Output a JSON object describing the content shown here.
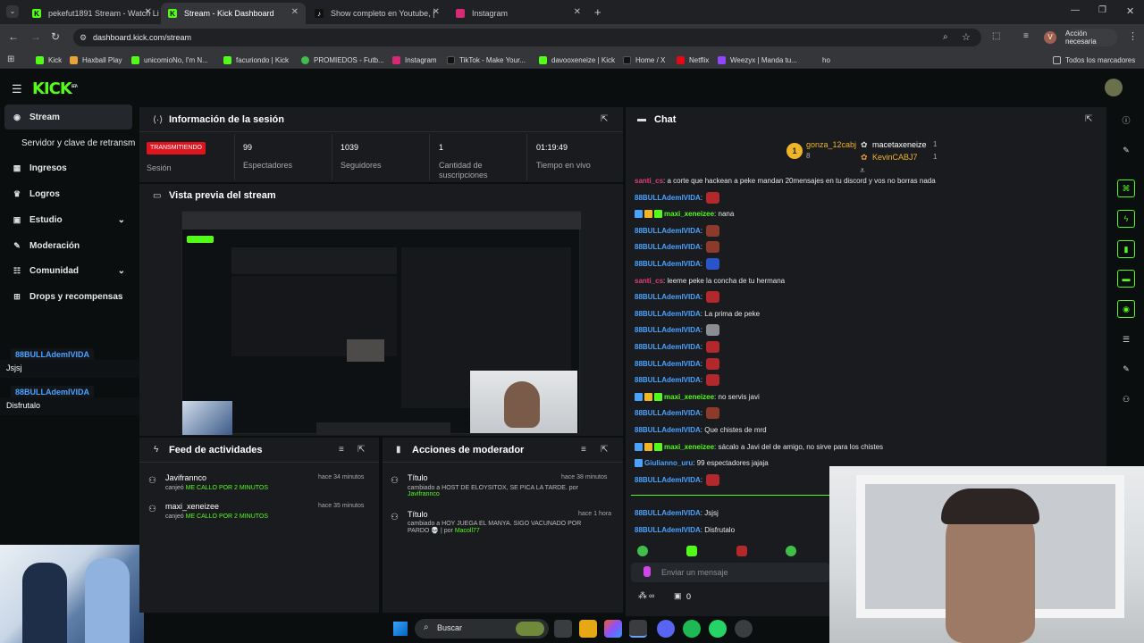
{
  "browser": {
    "tabs": [
      {
        "title": "pekefut1891 Stream - Watch Li",
        "active": false
      },
      {
        "title": "Stream - Kick Dashboard",
        "active": true
      },
      {
        "title": "Show completo en Youtube, |",
        "active": false
      },
      {
        "title": "Instagram",
        "active": false
      }
    ],
    "url": "dashboard.kick.com/stream",
    "action_required": "Acción necesaria",
    "profile_letter": "V",
    "bookmarks": [
      "Kick",
      "Haxball Play",
      "unicomioNo, I'm N...",
      "facuriondo | Kick",
      "PROMIEDOS - Futb...",
      "Instagram",
      "TikTok - Make Your...",
      "davooxeneize | Kick",
      "Home / X",
      "Netflix",
      "Weezyx | Manda tu...",
      "ho"
    ],
    "all_bookmarks": "Todos los marcadores"
  },
  "kick": {
    "logo": "KICK",
    "logo_sup": "BETA"
  },
  "sidebar": {
    "items": [
      {
        "label": "Stream",
        "icon": "stream-icon",
        "glyph": "((·))"
      },
      {
        "label": "Servidor y clave de retransm",
        "icon": "",
        "glyph": ""
      },
      {
        "label": "Ingresos",
        "icon": "revenue-icon",
        "glyph": "▦"
      },
      {
        "label": "Logros",
        "icon": "trophy-icon",
        "glyph": "♛"
      },
      {
        "label": "Estudio",
        "icon": "studio-icon",
        "glyph": "▣"
      },
      {
        "label": "Moderación",
        "icon": "wrench-icon",
        "glyph": "✎"
      },
      {
        "label": "Comunidad",
        "icon": "community-icon",
        "glyph": "☷"
      },
      {
        "label": "Drops y recompensas",
        "icon": "drops-icon",
        "glyph": "⊞"
      }
    ]
  },
  "session": {
    "title": "Información de la sesión",
    "live_badge": "TRANSMITIENDO",
    "live_label": "Sesión",
    "viewers_value": "99",
    "viewers_label": "Espectadores",
    "followers_value": "1039",
    "followers_label": "Seguidores",
    "subs_value": "1",
    "subs_label": "Cantidad de suscripciones",
    "time_value": "01:19:49",
    "time_label": "Tiempo en vivo"
  },
  "preview": {
    "title": "Vista previa del stream"
  },
  "activity": {
    "title": "Feed de actividades",
    "items": [
      {
        "user": "Javifrannco",
        "action": "canjeó",
        "reward": "ME CALLO POR 2 MINUTOS",
        "time": "hace 34 minutos"
      },
      {
        "user": "maxi_xeneizee",
        "action": "canjeó",
        "reward": "ME CALLO POR 2 MINUTOS",
        "time": "hace 35 minutos"
      }
    ]
  },
  "mod_actions": {
    "title": "Acciones de moderador",
    "items": [
      {
        "label": "Título",
        "time": "hace 38 minutos",
        "line1": "cambiado a HOST DE ELOYSITOX, SE PICA LA TARDE. por",
        "by": "Javifrannco",
        "line2": ""
      },
      {
        "label": "Título",
        "time": "hace 1 hora",
        "line1": "cambiado a HOY JUEGA EL MANYA. SIGO VACUNADO POR",
        "line2": "PARDO 💀 | por",
        "by": "Macoll77"
      }
    ]
  },
  "chat": {
    "title": "Chat",
    "leaders": [
      {
        "name": "gonza_12cabj",
        "count": "8",
        "rank": "1"
      },
      {
        "name": "macetaxeneize",
        "count": "1"
      },
      {
        "name": "KevinCABJ7",
        "count": "1"
      }
    ],
    "messages": [
      {
        "user": "santi_cs",
        "color": "#e0407a",
        "text": ": a corte que hackean a peke mandan 20mensajes en tu discord y vos no borras nada",
        "emote": "",
        "badges": false
      },
      {
        "user": "88BULLAdemIVIDA",
        "color": "#4aa3ff",
        "text": ":",
        "emote": "red",
        "badges": false
      },
      {
        "user": "maxi_xeneizee",
        "color": "#53fc18",
        "text": ": nana",
        "emote": "",
        "badges": true
      },
      {
        "user": "88BULLAdemIVIDA",
        "color": "#4aa3ff",
        "text": ":",
        "emote": "brown",
        "badges": false
      },
      {
        "user": "88BULLAdemIVIDA",
        "color": "#4aa3ff",
        "text": ":",
        "emote": "brown",
        "badges": false
      },
      {
        "user": "88BULLAdemIVIDA",
        "color": "#4aa3ff",
        "text": ":",
        "emote": "blue",
        "badges": false
      },
      {
        "user": "santi_cs",
        "color": "#e0407a",
        "text": ": leeme peke la concha de tu hermana",
        "emote": "",
        "badges": false
      },
      {
        "user": "88BULLAdemIVIDA",
        "color": "#4aa3ff",
        "text": ":",
        "emote": "red",
        "badges": false
      },
      {
        "user": "88BULLAdemIVIDA",
        "color": "#4aa3ff",
        "text": ": La prima de peke",
        "emote": "",
        "badges": false
      },
      {
        "user": "88BULLAdemIVIDA",
        "color": "#4aa3ff",
        "text": ":",
        "emote": "gray",
        "badges": false
      },
      {
        "user": "88BULLAdemIVIDA",
        "color": "#4aa3ff",
        "text": ":",
        "emote": "red",
        "badges": false
      },
      {
        "user": "88BULLAdemIVIDA",
        "color": "#4aa3ff",
        "text": ":",
        "emote": "red",
        "badges": false
      },
      {
        "user": "88BULLAdemIVIDA",
        "color": "#4aa3ff",
        "text": ":",
        "emote": "red",
        "badges": false
      },
      {
        "user": "maxi_xeneizee",
        "color": "#53fc18",
        "text": ": no servis javi",
        "emote": "",
        "badges": true
      },
      {
        "user": "88BULLAdemIVIDA",
        "color": "#4aa3ff",
        "text": ":",
        "emote": "brown",
        "badges": false
      },
      {
        "user": "88BULLAdemIVIDA",
        "color": "#4aa3ff",
        "text": ": Que chistes de mrd",
        "emote": "",
        "badges": false
      },
      {
        "user": "maxi_xeneizee",
        "color": "#53fc18",
        "text": ": sácalo a Javi del de amigo, no sirve para los chistes",
        "emote": "",
        "badges": true
      },
      {
        "user": "Giulianno_uru",
        "color": "#4aa3ff",
        "text": ": 99 espectadores jajaja",
        "emote": "",
        "badges": false,
        "single_badge": true
      },
      {
        "user": "88BULLAdemIVIDA",
        "color": "#4aa3ff",
        "text": ":",
        "emote": "red",
        "badges": false
      }
    ],
    "recent": [
      {
        "user": "88BULLAdemIVIDA",
        "text": ": Jsjsj"
      },
      {
        "user": "88BULLAdemIVIDA",
        "text": ": Disfrutalo"
      }
    ],
    "input_placeholder": "Enviar un mensaje",
    "points": "∞",
    "gift_count": "0"
  },
  "overlay": {
    "messages": [
      {
        "user": "88BULLAdemIVIDA",
        "text": "Jsjsj"
      },
      {
        "user": "88BULLAdemIVIDA",
        "text": "Disfrutalo"
      }
    ]
  },
  "taskbar": {
    "search": "Buscar"
  },
  "colors": {
    "kick_green": "#53fc18",
    "live_red": "#e0141e",
    "bg": "#0b0e0f",
    "panel": "#191b1f"
  }
}
